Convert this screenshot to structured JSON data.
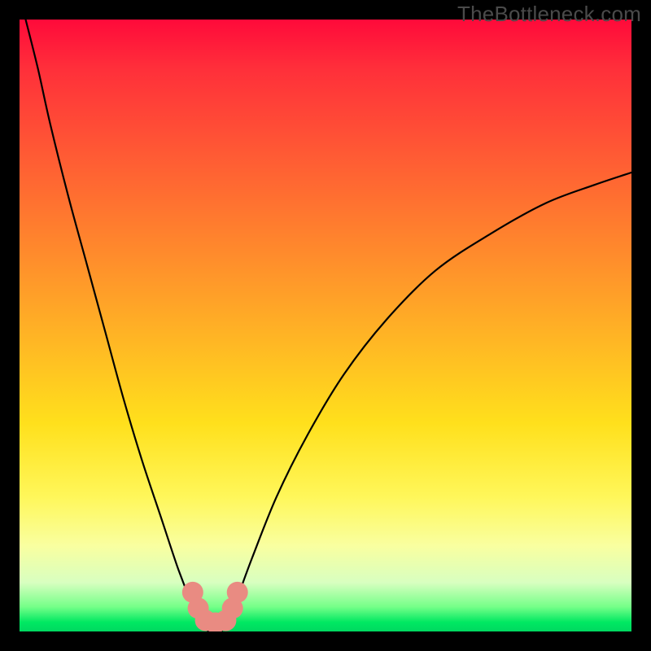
{
  "watermark": {
    "text": "TheBottleneck.com"
  },
  "chart_data": {
    "type": "line",
    "title": "",
    "xlabel": "",
    "ylabel": "",
    "ylim": [
      0,
      100
    ],
    "xlim": [
      0,
      100
    ],
    "gradient_stops": [
      {
        "pct": 0,
        "color": "#ff0a3a"
      },
      {
        "pct": 8,
        "color": "#ff2f3a"
      },
      {
        "pct": 22,
        "color": "#ff5a34"
      },
      {
        "pct": 38,
        "color": "#ff8a2c"
      },
      {
        "pct": 53,
        "color": "#ffb824"
      },
      {
        "pct": 66,
        "color": "#ffe01c"
      },
      {
        "pct": 78,
        "color": "#fff75a"
      },
      {
        "pct": 86,
        "color": "#f9ffa0"
      },
      {
        "pct": 92,
        "color": "#d8ffc0"
      },
      {
        "pct": 96,
        "color": "#74ff88"
      },
      {
        "pct": 98.5,
        "color": "#00e862"
      },
      {
        "pct": 100,
        "color": "#00d860"
      }
    ],
    "series": [
      {
        "name": "left-branch",
        "x": [
          1,
          3,
          5,
          8,
          11,
          14,
          17,
          20,
          23,
          26,
          28,
          30,
          31
        ],
        "y": [
          100,
          92,
          83,
          71,
          60,
          49,
          38,
          28,
          19,
          10,
          5,
          1,
          0
        ]
      },
      {
        "name": "right-branch",
        "x": [
          33,
          35,
          38,
          42,
          47,
          53,
          60,
          68,
          77,
          86,
          94,
          100
        ],
        "y": [
          0,
          4,
          12,
          22,
          32,
          42,
          51,
          59,
          65,
          70,
          73,
          75
        ]
      }
    ],
    "markers": {
      "name": "salmon-dots",
      "color": "#e98b82",
      "radius_px": 13,
      "x": [
        28.3,
        29.2,
        30.4,
        32.0,
        33.7,
        34.8,
        35.6
      ],
      "y": [
        6.4,
        3.8,
        1.8,
        1.4,
        1.8,
        3.8,
        6.4
      ]
    }
  }
}
